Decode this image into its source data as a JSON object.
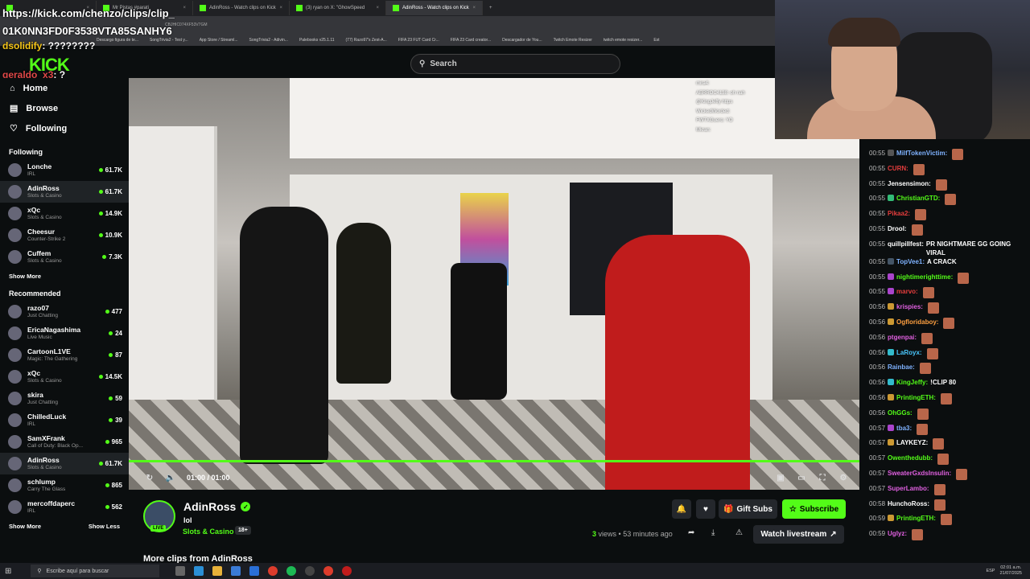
{
  "browser": {
    "tabs": [
      {
        "label": "",
        "active": false
      },
      {
        "label": "Mr Pistas #parati",
        "active": false
      },
      {
        "label": "AdinRoss - Watch clips on Kick",
        "active": false
      },
      {
        "label": "(3) ryan on X: \"GhowSpeed",
        "active": false
      },
      {
        "label": "AdinRoss - Watch clips on Kick",
        "active": true
      }
    ],
    "url_overlay_line1": "https://kick.com/chenzo/clips/clip_",
    "url_overlay_line2": "01K0NN3FD0F3538VTA85SANHY6",
    "url_small": "CBJHIC074XF53V7GM",
    "bookmarks": [
      "Descargo figura de te...",
      "SongTrivia2 - Test y...",
      "App Store / Streaml...",
      "SongTrivia2 - Adivin...",
      "Palebooks v25.1.11",
      "(77) Razo97's Zest-A...",
      "FIFA 23 FUT Card Cr...",
      "FIFA 23 Card creator...",
      "Descargador de You...",
      "Twitch Emote Resizer",
      "twitch emote resizer...",
      "Est"
    ]
  },
  "overlay_chat": [
    {
      "user": "dsolidify",
      "text": ": ????????",
      "color": "#f5c518"
    },
    {
      "user": "geraldo_x3",
      "text": ": ?",
      "color": "#e04848"
    }
  ],
  "logo": "KICK",
  "search": {
    "placeholder": "Search"
  },
  "nav": {
    "home": "Home",
    "browse": "Browse",
    "following": "Following"
  },
  "sidebar": {
    "following_title": "Following",
    "following": [
      {
        "name": "Lonche",
        "category": "IRL",
        "viewers": "61.7K",
        "selected": false
      },
      {
        "name": "AdinRoss",
        "category": "Slots & Casino",
        "viewers": "61.7K",
        "selected": true
      },
      {
        "name": "xQc",
        "category": "Slots & Casino",
        "viewers": "14.9K",
        "selected": false
      },
      {
        "name": "Cheesur",
        "category": "Counter-Strike 2",
        "viewers": "10.9K",
        "selected": false
      },
      {
        "name": "Cuffem",
        "category": "Slots & Casino",
        "viewers": "7.3K",
        "selected": false
      }
    ],
    "show_more_1": "Show More",
    "recommended_title": "Recommended",
    "recommended": [
      {
        "name": "razo07",
        "category": "Just Chatting",
        "viewers": "477",
        "selected": false
      },
      {
        "name": "EricaNagashima",
        "category": "Live Music",
        "viewers": "24",
        "selected": false
      },
      {
        "name": "CartoonL1VE",
        "category": "Magic: The Gathering",
        "viewers": "87",
        "selected": false
      },
      {
        "name": "xQc",
        "category": "Slots & Casino",
        "viewers": "14.5K",
        "selected": false
      },
      {
        "name": "skira",
        "category": "Just Chatting",
        "viewers": "59",
        "selected": false
      },
      {
        "name": "ChilledLuck",
        "category": "IRL",
        "viewers": "39",
        "selected": false
      },
      {
        "name": "SamXFrank",
        "category": "Call of Duty: Black Op...",
        "viewers": "965",
        "selected": false
      },
      {
        "name": "AdinRoss",
        "category": "Slots & Casino",
        "viewers": "61.7K",
        "selected": true
      },
      {
        "name": "schlump",
        "category": "Carry The Glass",
        "viewers": "865",
        "selected": false
      },
      {
        "name": "mercoffdaperc",
        "category": "IRL",
        "viewers": "562",
        "selected": false
      }
    ],
    "show_more_2": "Show More",
    "show_less": "Show Less"
  },
  "player": {
    "time": "01:00 / 01:00",
    "progress": 1.0,
    "stream_chat": [
      "mira4:",
      "AERROC4138: oh nah",
      "@KingJeffy https",
      "WickedWorded:",
      "",
      "FWTXGuero: YO",
      "Mkran:",
      ""
    ]
  },
  "clip": {
    "streamer": "AdinRoss",
    "title": "lol",
    "category": "Slots & Casino",
    "age_badge": "18+",
    "live_badge": "LIVE",
    "views_count": "3",
    "views_text": "views • 53 minutes ago",
    "gift_label": "Gift Subs",
    "subscribe_label": "Subscribe",
    "watch_label": "Watch livestream",
    "more_clips": "More clips from AdinRoss"
  },
  "chat": [
    {
      "time": "00:55",
      "user": "MilfTokenVictim:",
      "text": "",
      "color": "#7fb2ff",
      "badge": "#555"
    },
    {
      "time": "00:55",
      "user": "CURN:",
      "text": "",
      "color": "#e53d3d",
      "badge": ""
    },
    {
      "time": "00:55",
      "user": "Jensensimon:",
      "text": "",
      "color": "#ffffff",
      "badge": ""
    },
    {
      "time": "00:55",
      "user": "ChristianGTD:",
      "text": "",
      "color": "#53fc18",
      "badge": "#3b7"
    },
    {
      "time": "00:55",
      "user": "Pikaa2:",
      "text": "",
      "color": "#e53d3d",
      "badge": ""
    },
    {
      "time": "00:55",
      "user": "Drool:",
      "text": "",
      "color": "#ffffff",
      "badge": ""
    },
    {
      "time": "00:55",
      "user": "quillpillfest:",
      "text": "PR NIGHTMARE GG GOING VIRAL",
      "color": "#ffffff",
      "badge": ""
    },
    {
      "time": "00:55",
      "user": "TopVee1:",
      "text": "A CRACK",
      "color": "#7fb2ff",
      "badge": "#456"
    },
    {
      "time": "00:55",
      "user": "nightimerighttime:",
      "text": "",
      "color": "#53fc18",
      "badge": "#a4c"
    },
    {
      "time": "00:55",
      "user": "marvo:",
      "text": "",
      "color": "#e53d3d",
      "badge": "#a4c"
    },
    {
      "time": "00:56",
      "user": "krispies:",
      "text": "",
      "color": "#e060e0",
      "badge": "#c93"
    },
    {
      "time": "00:56",
      "user": "Ogfloridaboy:",
      "text": "",
      "color": "#ffa040",
      "badge": "#c93"
    },
    {
      "time": "00:56",
      "user": "ptgenpai:",
      "text": "",
      "color": "#e060e0",
      "badge": ""
    },
    {
      "time": "00:56",
      "user": "LaRoyx:",
      "text": "",
      "color": "#4ac8ff",
      "badge": "#3bc"
    },
    {
      "time": "00:56",
      "user": "Rainbae:",
      "text": "",
      "color": "#7fb2ff",
      "badge": ""
    },
    {
      "time": "00:56",
      "user": "KingJeffy:",
      "text": "!CLIP 80",
      "color": "#53fc18",
      "badge": "#3bc"
    },
    {
      "time": "00:56",
      "user": "PrintingETH:",
      "text": "",
      "color": "#53fc18",
      "badge": "#c93"
    },
    {
      "time": "00:56",
      "user": "OhGGs:",
      "text": "",
      "color": "#53fc18",
      "badge": ""
    },
    {
      "time": "00:57",
      "user": "tba3:",
      "text": "",
      "color": "#7fb2ff",
      "badge": "#a4c"
    },
    {
      "time": "00:57",
      "user": "LAYKEYZ:",
      "text": "",
      "color": "#ffffff",
      "badge": "#c93"
    },
    {
      "time": "00:57",
      "user": "Owenthedubb:",
      "text": "",
      "color": "#53fc18",
      "badge": ""
    },
    {
      "time": "00:57",
      "user": "SweaterGxdsInsulin:",
      "text": "",
      "color": "#e060e0",
      "badge": ""
    },
    {
      "time": "00:57",
      "user": "SuperLambo:",
      "text": "",
      "color": "#e060e0",
      "badge": ""
    },
    {
      "time": "00:58",
      "user": "HunchoRoss:",
      "text": "",
      "color": "#ffffff",
      "badge": ""
    },
    {
      "time": "00:59",
      "user": "PrintingETH:",
      "text": "",
      "color": "#53fc18",
      "badge": "#c93"
    },
    {
      "time": "00:59",
      "user": "Uglyz:",
      "text": "",
      "color": "#e060e0",
      "badge": ""
    }
  ],
  "taskbar": {
    "search_placeholder": "Escribe aquí para buscar",
    "lang": "ESP",
    "clock_time": "02:01 a.m.",
    "clock_date": "21/07/2025"
  },
  "colors": {
    "accent": "#53fc18",
    "background": "#0b0e0f",
    "panel": "#24272c"
  }
}
